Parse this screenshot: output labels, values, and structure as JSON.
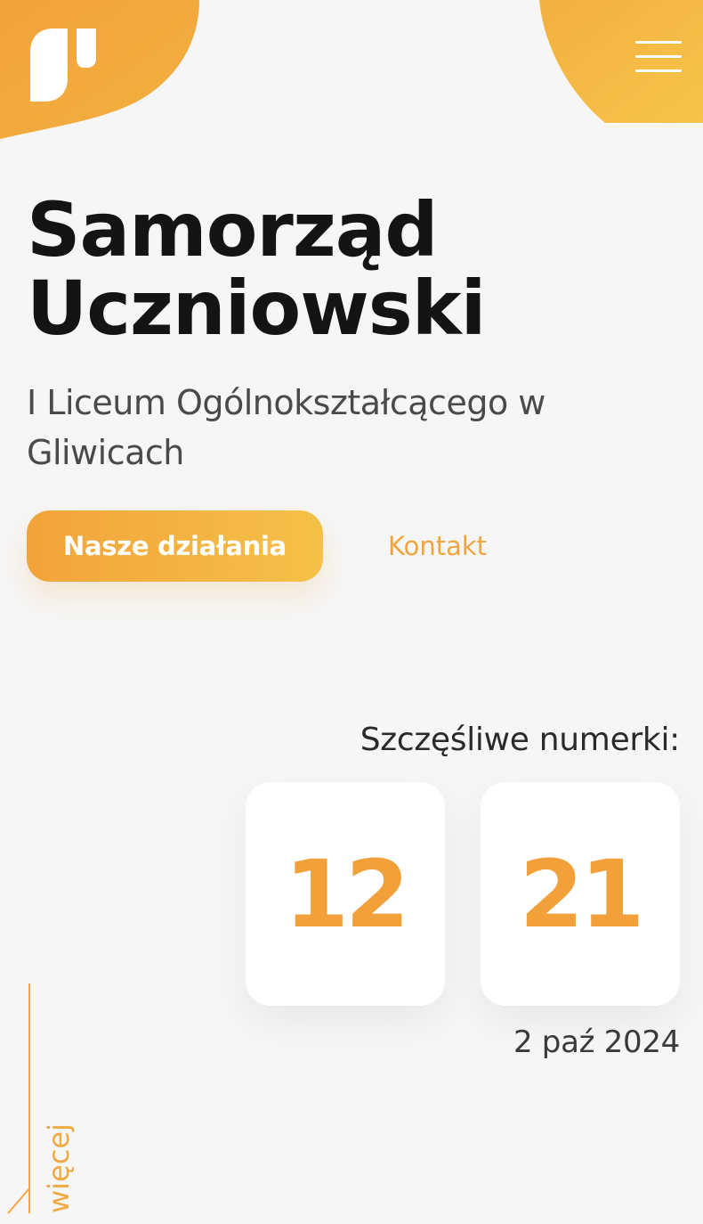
{
  "header": {
    "logo_icon": "school-logo-icon",
    "menu_icon": "hamburger-menu-icon",
    "accent_color": "#f2a33a",
    "accent_color_light": "#f5c148"
  },
  "hero": {
    "title_line1": "Samorząd",
    "title_line2": "Uczniowski",
    "subtitle": "I Liceum Ogólnokształcącego w Gliwicach",
    "primary_button": "Nasze działania",
    "secondary_link": "Kontakt"
  },
  "lucky_numbers": {
    "label": "Szczęśliwe numerki:",
    "numbers": [
      "12",
      "21"
    ],
    "date": "2 paź 2024"
  },
  "scroll_hint": {
    "label": "więcej",
    "icon": "arrow-down-left-icon"
  }
}
